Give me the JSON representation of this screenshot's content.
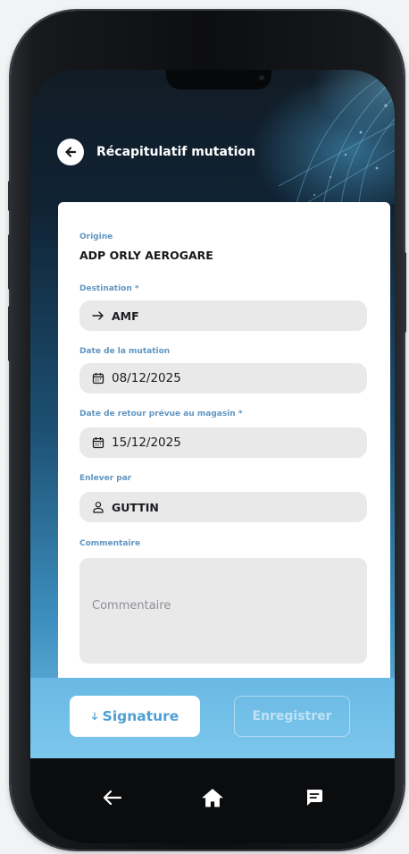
{
  "header": {
    "title": "Récapitulatif mutation",
    "back_icon": "arrow-left-icon"
  },
  "form": {
    "origin": {
      "label": "Origine",
      "value": "ADP ORLY AEROGARE"
    },
    "destination": {
      "label": "Destination *",
      "value": "AMF",
      "icon": "arrow-right-icon"
    },
    "mutation_date": {
      "label": "Date de la mutation",
      "value": "08/12/2025",
      "icon": "calendar-icon"
    },
    "return_date": {
      "label": "Date de retour prévue au magasin *",
      "value": "15/12/2025",
      "icon": "calendar-icon"
    },
    "removed_by": {
      "label": "Enlever par",
      "value": "GUTTIN",
      "icon": "user-icon"
    },
    "comment": {
      "label": "Commentaire",
      "placeholder": "Commentaire",
      "value": ""
    }
  },
  "actions": {
    "signature_label": "Signature",
    "signature_icon": "arrow-down-icon",
    "save_label": "Enregistrer"
  },
  "nav": {
    "back_icon": "back-arrow-icon",
    "home_icon": "home-icon",
    "chat_icon": "chat-icon"
  },
  "colors": {
    "label_blue": "#5f95c2",
    "accent_blue": "#4d9fd4",
    "action_bar": "#74c0e6",
    "field_bg": "#e9e9ea"
  }
}
